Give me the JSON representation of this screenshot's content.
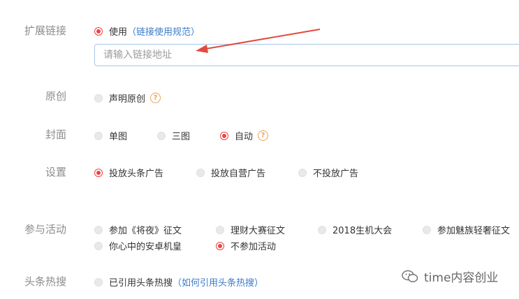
{
  "form": {
    "extended_link": {
      "label": "扩展链接",
      "option": "使用",
      "paren_open": "（",
      "link": "链接使用规范",
      "paren_close": "）",
      "input_placeholder": "请输入链接地址"
    },
    "original": {
      "label": "原创",
      "option": "声明原创",
      "help": "?"
    },
    "cover": {
      "label": "封面",
      "options": [
        "单图",
        "三图",
        "自动"
      ],
      "selected": "自动",
      "help": "?"
    },
    "settings": {
      "label": "设置",
      "options": [
        "投放头条广告",
        "投放自营广告",
        "不投放广告"
      ],
      "selected": "投放头条广告"
    },
    "activity": {
      "label": "参与活动",
      "options": [
        "参加《将夜》征文",
        "理财大赛征文",
        "2018生机大会",
        "参加魅族轻奢征文",
        "你心中的安卓机皇",
        "不参加活动"
      ],
      "selected": "不参加活动"
    },
    "hot_search": {
      "label": "头条热搜",
      "option": "已引用头条热搜",
      "paren_open": "（",
      "link": "如何引用头条热搜",
      "paren_close": "）"
    }
  },
  "watermark": {
    "text": "time内容创业"
  },
  "colors": {
    "accent_red": "#f04142",
    "link_blue": "#3c7bc8",
    "help_orange": "#f0a050",
    "label_gray": "#8c8c8c"
  }
}
